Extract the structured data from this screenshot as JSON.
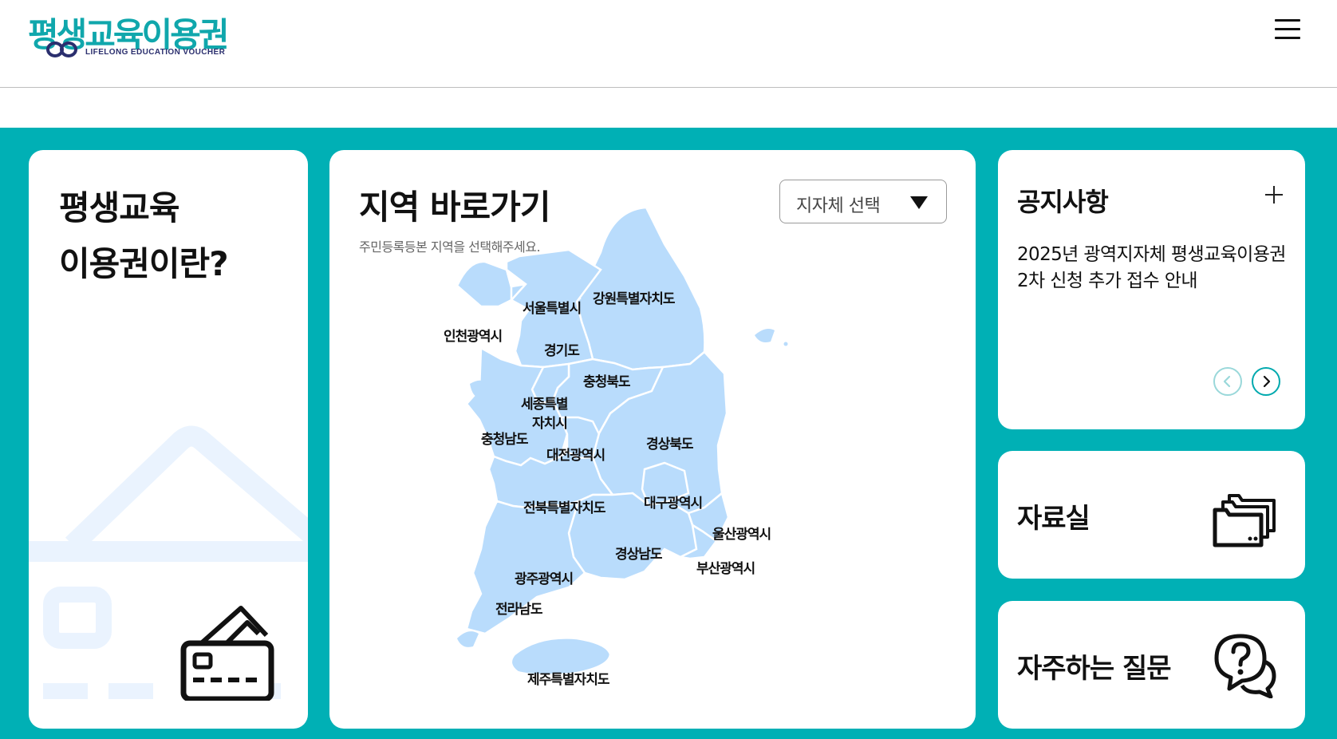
{
  "header": {
    "logo_title": "평생교육이용권",
    "logo_subtitle": "LIFELONG EDUCATION VOUCHER",
    "menu_icon": "hamburger-icon"
  },
  "about_card": {
    "title_line1": "평생교육",
    "title_line2": "이용권이란?",
    "icon": "credit-card-icon"
  },
  "map_card": {
    "title": "지역 바로가기",
    "subtitle": "주민등록등본 지역을 선택해주세요.",
    "select_placeholder": "지자체 선택",
    "select_icon": "triangle-down-icon",
    "regions": {
      "seoul": "서울특별시",
      "gangwon": "강원특별자치도",
      "incheon": "인천광역시",
      "gyeonggi": "경기도",
      "chungbuk": "충청북도",
      "sejong_line1": "세종특별",
      "sejong_line2": "자치시",
      "chungnam": "충청남도",
      "daejeon": "대전광역시",
      "gyeongbuk": "경상북도",
      "daegu": "대구광역시",
      "jeonbuk": "전북특별자치도",
      "ulsan": "울산광역시",
      "gyeongnam": "경상남도",
      "busan": "부산광역시",
      "gwangju": "광주광역시",
      "jeonnam": "전라남도",
      "jeju": "제주특별자치도"
    }
  },
  "notice_card": {
    "title": "공지사항",
    "more_icon": "plus-icon",
    "item_text": "2025년 광역지자체 평생교육이용권 2차 신청 추가 접수 안내",
    "prev_icon": "chevron-left-icon",
    "next_icon": "chevron-right-icon"
  },
  "archive_card": {
    "title": "자료실",
    "icon": "folders-icon"
  },
  "faq_card": {
    "title": "자주하는 질문",
    "icon": "question-bubble-icon"
  },
  "colors": {
    "brand_teal": "#00b0b5",
    "map_region": "#b9dcfc",
    "logo_navy": "#2b2f6e"
  }
}
